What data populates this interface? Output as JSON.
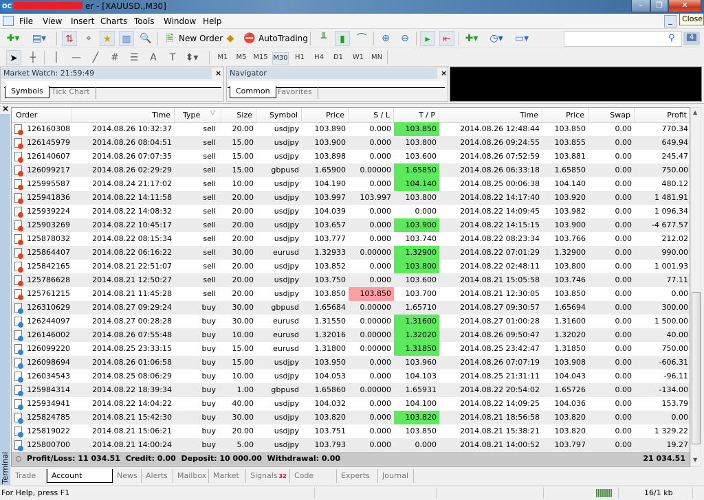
{
  "window": {
    "title": "er - [XAUUSD.,M30]",
    "logo": "OC",
    "tooltip": "Close"
  },
  "menu": [
    "File",
    "View",
    "Insert",
    "Charts",
    "Tools",
    "Window",
    "Help"
  ],
  "toolbar": {
    "new_order": "New Order",
    "autotrading": "AutoTrading",
    "notifications": "4"
  },
  "timeframes": [
    "M1",
    "M5",
    "M15",
    "M30",
    "H1",
    "H4",
    "D1",
    "W1",
    "MN"
  ],
  "selected_timeframe": "M30",
  "market_watch": {
    "title": "Market Watch: 21:59:49",
    "tabs": [
      "Symbols",
      "Tick Chart"
    ]
  },
  "navigator": {
    "title": "Navigator",
    "tabs": [
      "Common",
      "Favorites"
    ]
  },
  "terminal": {
    "label": "Terminal",
    "columns": [
      "Order",
      "Time",
      "Type",
      "Size",
      "Symbol",
      "Price",
      "S / L",
      "T / P",
      "Time",
      "Price",
      "Swap",
      "Profit"
    ],
    "rows": [
      [
        "126160308",
        "2014.08.26 10:32:37",
        "sell",
        "20.00",
        "usdjpy",
        "103.890",
        "0.000",
        "103.850",
        "2014.08.26 12:48:44",
        "103.850",
        "0.00",
        "770.34",
        "",
        "tp"
      ],
      [
        "126145979",
        "2014.08.26 08:04:51",
        "sell",
        "15.00",
        "usdjpy",
        "103.900",
        "0.000",
        "103.800",
        "2014.08.26 09:24:55",
        "103.855",
        "0.00",
        "649.94",
        "",
        ""
      ],
      [
        "126140607",
        "2014.08.26 07:07:35",
        "sell",
        "15.00",
        "usdjpy",
        "103.898",
        "0.000",
        "103.600",
        "2014.08.26 07:52:59",
        "103.881",
        "0.00",
        "245.47",
        "",
        ""
      ],
      [
        "126099217",
        "2014.08.26 02:29:29",
        "sell",
        "15.00",
        "gbpusd",
        "1.65900",
        "0.00000",
        "1.65850",
        "2014.08.26 06:33:18",
        "1.65850",
        "0.00",
        "750.00",
        "",
        "tp"
      ],
      [
        "125995587",
        "2014.08.24 21:17:02",
        "sell",
        "10.00",
        "usdjpy",
        "104.190",
        "0.000",
        "104.140",
        "2014.08.25 00:06:38",
        "104.140",
        "0.00",
        "480.12",
        "",
        "tp"
      ],
      [
        "125941836",
        "2014.08.22 14:11:58",
        "sell",
        "20.00",
        "usdjpy",
        "103.997",
        "103.997",
        "103.800",
        "2014.08.22 14:17:40",
        "103.920",
        "0.00",
        "1 481.91",
        "",
        ""
      ],
      [
        "125939224",
        "2014.08.22 14:08:32",
        "sell",
        "20.00",
        "usdjpy",
        "104.039",
        "0.000",
        "0.000",
        "2014.08.22 14:09:45",
        "103.982",
        "0.00",
        "1 096.34",
        "",
        ""
      ],
      [
        "125903269",
        "2014.08.22 10:45:17",
        "sell",
        "20.00",
        "usdjpy",
        "103.657",
        "0.000",
        "103.900",
        "2014.08.22 14:15:15",
        "103.900",
        "0.00",
        "-4 677.57",
        "",
        "tp"
      ],
      [
        "125878032",
        "2014.08.22 08:15:34",
        "sell",
        "20.00",
        "usdjpy",
        "103.777",
        "0.000",
        "103.740",
        "2014.08.22 08:23:34",
        "103.766",
        "0.00",
        "212.02",
        "",
        ""
      ],
      [
        "125864407",
        "2014.08.22 06:16:22",
        "sell",
        "30.00",
        "eurusd",
        "1.32933",
        "0.00000",
        "1.32900",
        "2014.08.22 07:01:29",
        "1.32900",
        "0.00",
        "990.00",
        "",
        "tp"
      ],
      [
        "125842165",
        "2014.08.21 22:51:07",
        "sell",
        "20.00",
        "usdjpy",
        "103.852",
        "0.000",
        "103.800",
        "2014.08.22 02:48:11",
        "103.800",
        "0.00",
        "1 001.93",
        "",
        "tp"
      ],
      [
        "125786628",
        "2014.08.21 12:50:27",
        "sell",
        "20.00",
        "usdjpy",
        "103.750",
        "0.000",
        "103.600",
        "2014.08.21 15:05:58",
        "103.746",
        "0.00",
        "77.11",
        "",
        ""
      ],
      [
        "125761215",
        "2014.08.21 11:45:28",
        "sell",
        "20.00",
        "usdjpy",
        "103.850",
        "103.850",
        "103.700",
        "2014.08.21 12:30:05",
        "103.850",
        "0.00",
        "0.00",
        "sl",
        ""
      ],
      [
        "126310629",
        "2014.08.27 09:29:24",
        "buy",
        "30.00",
        "gbpusd",
        "1.65684",
        "0.00000",
        "1.65710",
        "2014.08.27 09:30:57",
        "1.65694",
        "0.00",
        "300.00",
        "",
        ""
      ],
      [
        "126244097",
        "2014.08.27 00:28:28",
        "buy",
        "30.00",
        "eurusd",
        "1.31550",
        "0.00000",
        "1.31600",
        "2014.08.27 01:00:28",
        "1.31600",
        "0.00",
        "1 500.00",
        "",
        "tp"
      ],
      [
        "126146002",
        "2014.08.26 07:55:48",
        "buy",
        "10.00",
        "eurusd",
        "1.32016",
        "0.00000",
        "1.32020",
        "2014.08.26 09:50:47",
        "1.32020",
        "0.00",
        "40.00",
        "",
        "tp"
      ],
      [
        "126099220",
        "2014.08.25 23:33:15",
        "buy",
        "15.00",
        "eurusd",
        "1.31800",
        "0.00000",
        "1.31850",
        "2014.08.25 23:42:47",
        "1.31850",
        "0.00",
        "750.00",
        "",
        "tp"
      ],
      [
        "126098694",
        "2014.08.26 01:06:58",
        "buy",
        "15.00",
        "usdjpy",
        "103.950",
        "0.000",
        "103.960",
        "2014.08.26 07:07:19",
        "103.908",
        "0.00",
        "-606.31",
        "",
        ""
      ],
      [
        "126034543",
        "2014.08.25 08:06:29",
        "buy",
        "10.00",
        "usdjpy",
        "104.053",
        "0.000",
        "104.103",
        "2014.08.25 21:31:11",
        "104.043",
        "0.00",
        "-96.11",
        "",
        ""
      ],
      [
        "125984314",
        "2014.08.22 18:39:34",
        "buy",
        "1.00",
        "gbpusd",
        "1.65860",
        "0.00000",
        "1.65931",
        "2014.08.22 20:54:02",
        "1.65726",
        "0.00",
        "-134.00",
        "",
        ""
      ],
      [
        "125934941",
        "2014.08.22 14:04:22",
        "buy",
        "40.00",
        "usdjpy",
        "104.032",
        "0.000",
        "104.100",
        "2014.08.22 14:09:25",
        "104.036",
        "0.00",
        "153.79",
        "",
        ""
      ],
      [
        "125824785",
        "2014.08.21 15:42:30",
        "buy",
        "30.00",
        "usdjpy",
        "103.820",
        "0.000",
        "103.820",
        "2014.08.21 18:56:58",
        "103.820",
        "0.00",
        "0.00",
        "",
        "tp"
      ],
      [
        "125819022",
        "2014.08.21 15:06:21",
        "buy",
        "20.00",
        "usdjpy",
        "103.751",
        "0.000",
        "103.850",
        "2014.08.21 15:38:21",
        "103.820",
        "0.00",
        "1 329.22",
        "",
        ""
      ],
      [
        "125800700",
        "2014.08.21 14:00:24",
        "buy",
        "5.00",
        "usdjpy",
        "103.793",
        "0.000",
        "0.000",
        "2014.08.21 14:00:52",
        "103.797",
        "0.00",
        "19.27",
        "",
        ""
      ]
    ],
    "summary": {
      "text": "Profit/Loss: 11 034.51  Credit: 0.00  Deposit: 10 000.00  Withdrawal: 0.00",
      "total": "21 034.51"
    },
    "tabs": [
      "Trade",
      "Account History",
      "News",
      "Alerts",
      "Mailbox",
      "Market",
      "Signals",
      "Code Base",
      "Experts",
      "Journal"
    ],
    "active_tab": "Account History",
    "signals_badge": "32"
  },
  "status": {
    "help": "For Help, press F1",
    "traffic": "16/1 kb"
  },
  "colors": {
    "tp_hit": "#5de85d",
    "sl_hit": "#f9a0a0",
    "sell_icon": "#e0401a",
    "buy_icon": "#2a84d8"
  }
}
